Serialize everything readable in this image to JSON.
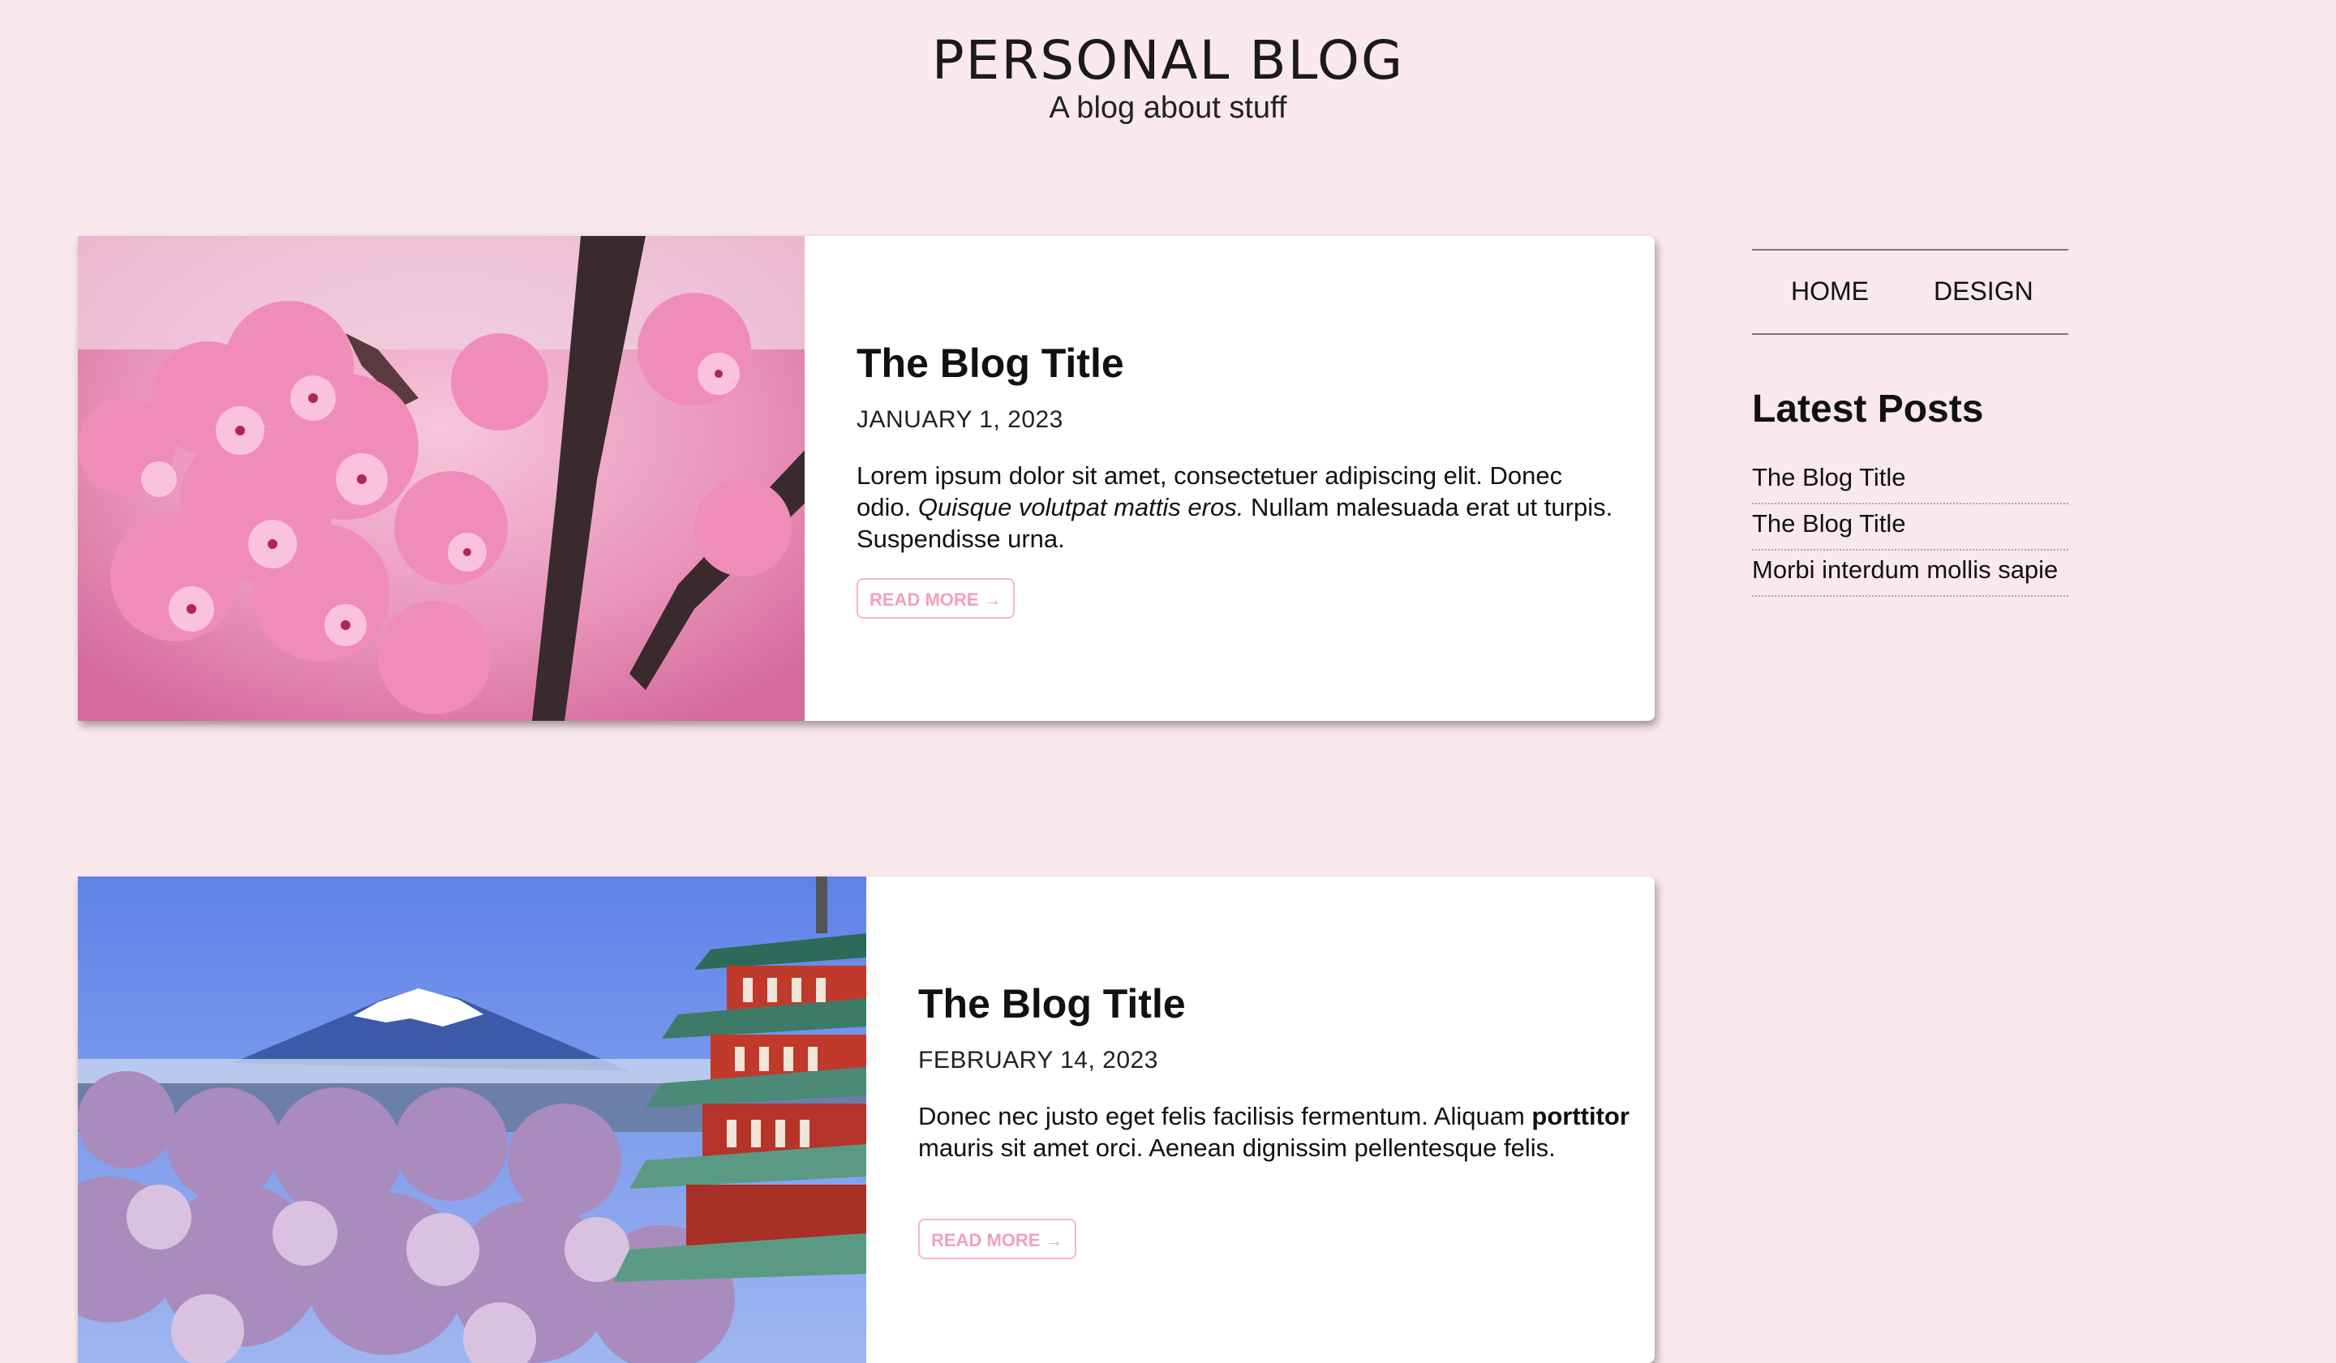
{
  "header": {
    "title": "PERSONAL BLOG",
    "subtitle": "A blog about stuff"
  },
  "posts": [
    {
      "title": "The Blog Title",
      "date": "JANUARY 1, 2023",
      "excerpt_a": "Lorem ipsum dolor sit amet, consectetuer adipiscing elit. Donec odio. ",
      "excerpt_emphasis": "Quisque volutpat mattis eros.",
      "excerpt_b": " Nullam malesuada erat ut turpis. Suspendisse urna.",
      "read_more": "READ MORE →",
      "image_icon": "cherry-blossom-photo"
    },
    {
      "title": "The Blog Title",
      "date": "FEBRUARY 14, 2023",
      "excerpt_a": "Donec nec justo eget felis facilisis fermentum. Aliquam ",
      "excerpt_emphasis": "porttitor",
      "excerpt_b": " mauris sit amet orci. Aenean dignissim pellentesque felis.",
      "read_more": "READ MORE →",
      "image_icon": "mount-fuji-pagoda-photo"
    }
  ],
  "sidebar": {
    "nav": [
      "HOME",
      "DESIGN"
    ],
    "latest_heading": "Latest Posts",
    "latest_posts": [
      "The Blog Title",
      "The Blog Title",
      "Morbi interdum mollis sapie"
    ]
  },
  "colors": {
    "background": "#f9e8ec",
    "accent": "#f4a0b8"
  }
}
